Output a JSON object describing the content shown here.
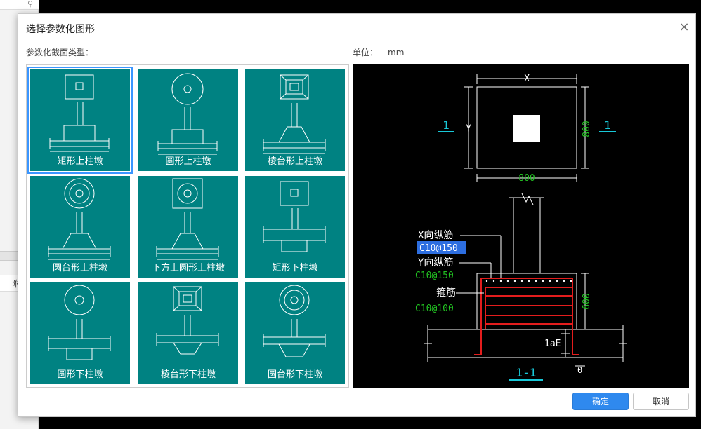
{
  "dialog": {
    "title": "选择参数化图形",
    "close_glyph": "×",
    "types_label": "参数化截面类型：",
    "unit_label": "单位：",
    "unit_value": "mm",
    "ok_label": "确定",
    "cancel_label": "取消"
  },
  "background": {
    "cell_text": "附"
  },
  "shapes": [
    {
      "label": "矩形上柱墩",
      "selected": true
    },
    {
      "label": "圆形上柱墩",
      "selected": false
    },
    {
      "label": "棱台形上柱墩",
      "selected": false
    },
    {
      "label": "圆台形上柱墩",
      "selected": false
    },
    {
      "label": "下方上圆形上柱墩",
      "selected": false
    },
    {
      "label": "矩形下柱墩",
      "selected": false
    },
    {
      "label": "圆形下柱墩",
      "selected": false
    },
    {
      "label": "棱台形下柱墩",
      "selected": false
    },
    {
      "label": "圆台形下柱墩",
      "selected": false
    }
  ],
  "preview": {
    "dim_x": "X",
    "dim_y": "Y",
    "dim_800_bottom": "800",
    "dim_800_right": "800",
    "section_mark_left": "1",
    "section_mark_right": "1",
    "x_rebar_label": "X向纵筋",
    "x_rebar_value": "C10@150",
    "y_rebar_label": "Y向纵筋",
    "y_rebar_value": "C10@150",
    "stirrup_label": "箍筋",
    "stirrup_value": "C10@100",
    "dim_600": "600",
    "dim_lae": "1aE",
    "dim_0": "0",
    "section_title": "1-1"
  },
  "colors": {
    "tile_bg": "#008282",
    "accent": "#2f89ee",
    "rebar": "#e41d1d",
    "cad_green": "#22c322",
    "cad_cyan": "#18c8d8"
  }
}
